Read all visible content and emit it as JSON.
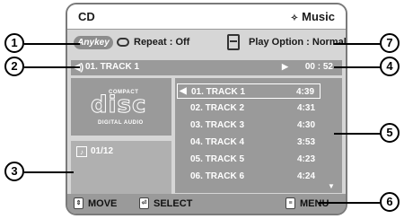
{
  "header": {
    "source": "CD",
    "mode_icon": "music-note-icon",
    "mode": "Music"
  },
  "options": {
    "anykey_label": "Anykey",
    "repeat_label": "Repeat : Off",
    "play_option_label": "Play Option : Normal"
  },
  "now_playing": {
    "track": "01. TRACK 1",
    "elapsed": "00 : 52"
  },
  "logo": {
    "top": "COMPACT",
    "main": "disc",
    "bottom": "DIGITAL AUDIO"
  },
  "track_count": "01/12",
  "tracks": [
    {
      "name": "01. TRACK 1",
      "time": "4:39"
    },
    {
      "name": "02. TRACK 2",
      "time": "4:31"
    },
    {
      "name": "03. TRACK 3",
      "time": "4:30"
    },
    {
      "name": "04. TRACK 4",
      "time": "3:53"
    },
    {
      "name": "05. TRACK 5",
      "time": "4:23"
    },
    {
      "name": "06. TRACK 6",
      "time": "4:24"
    }
  ],
  "footer": {
    "move_label": "MOVE",
    "select_label": "SELECT",
    "menu_label": "MENU"
  },
  "callouts": [
    "1",
    "2",
    "3",
    "4",
    "5",
    "6",
    "7"
  ]
}
